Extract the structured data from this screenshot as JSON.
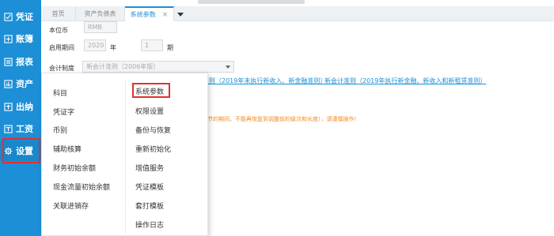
{
  "sidebar": {
    "items": [
      {
        "label": "凭证",
        "icon": "voucher-icon"
      },
      {
        "label": "账簿",
        "icon": "ledger-icon"
      },
      {
        "label": "报表",
        "icon": "report-icon"
      },
      {
        "label": "资产",
        "icon": "asset-icon"
      },
      {
        "label": "出纳",
        "icon": "cashier-icon"
      },
      {
        "label": "工资",
        "icon": "payroll-icon"
      },
      {
        "label": "设置",
        "icon": "gear-icon"
      }
    ],
    "active_index": 6,
    "color": "#1c8fd6"
  },
  "tabs": [
    {
      "label": "首页"
    },
    {
      "label": "资产负债表"
    },
    {
      "label": "系统参数",
      "close": "×"
    }
  ],
  "form": {
    "currency_label": "本位币",
    "currency_value": "RMB",
    "period_label": "启用期间",
    "period_year": "2020",
    "year_unit": "年",
    "period_no": "1",
    "period_unit": "期",
    "standard_label": "会计制度",
    "standard_value": "新会计准则（2006年版）"
  },
  "links": {
    "link1": "准则（2019年未执行新收入、新金融准则）",
    "link2": "新会计准则（2019年执行新金融、新收入和新租赁准则）"
  },
  "warning": "节的期间，不能再恢复到调整前的级次和长度），请谨慎操作!",
  "menu": {
    "left": [
      "科目",
      "凭证字",
      "币别",
      "辅助核算",
      "财务初始余额",
      "现金流量初始余额",
      "关联进销存"
    ],
    "right": [
      "系统参数",
      "权限设置",
      "备份与恢复",
      "重新初始化",
      "增值服务",
      "凭证模板",
      "套打模板",
      "操作日志"
    ]
  },
  "colors": {
    "accent": "#1c8fd6",
    "highlight": "#e23030",
    "warning": "#f08a1c"
  }
}
